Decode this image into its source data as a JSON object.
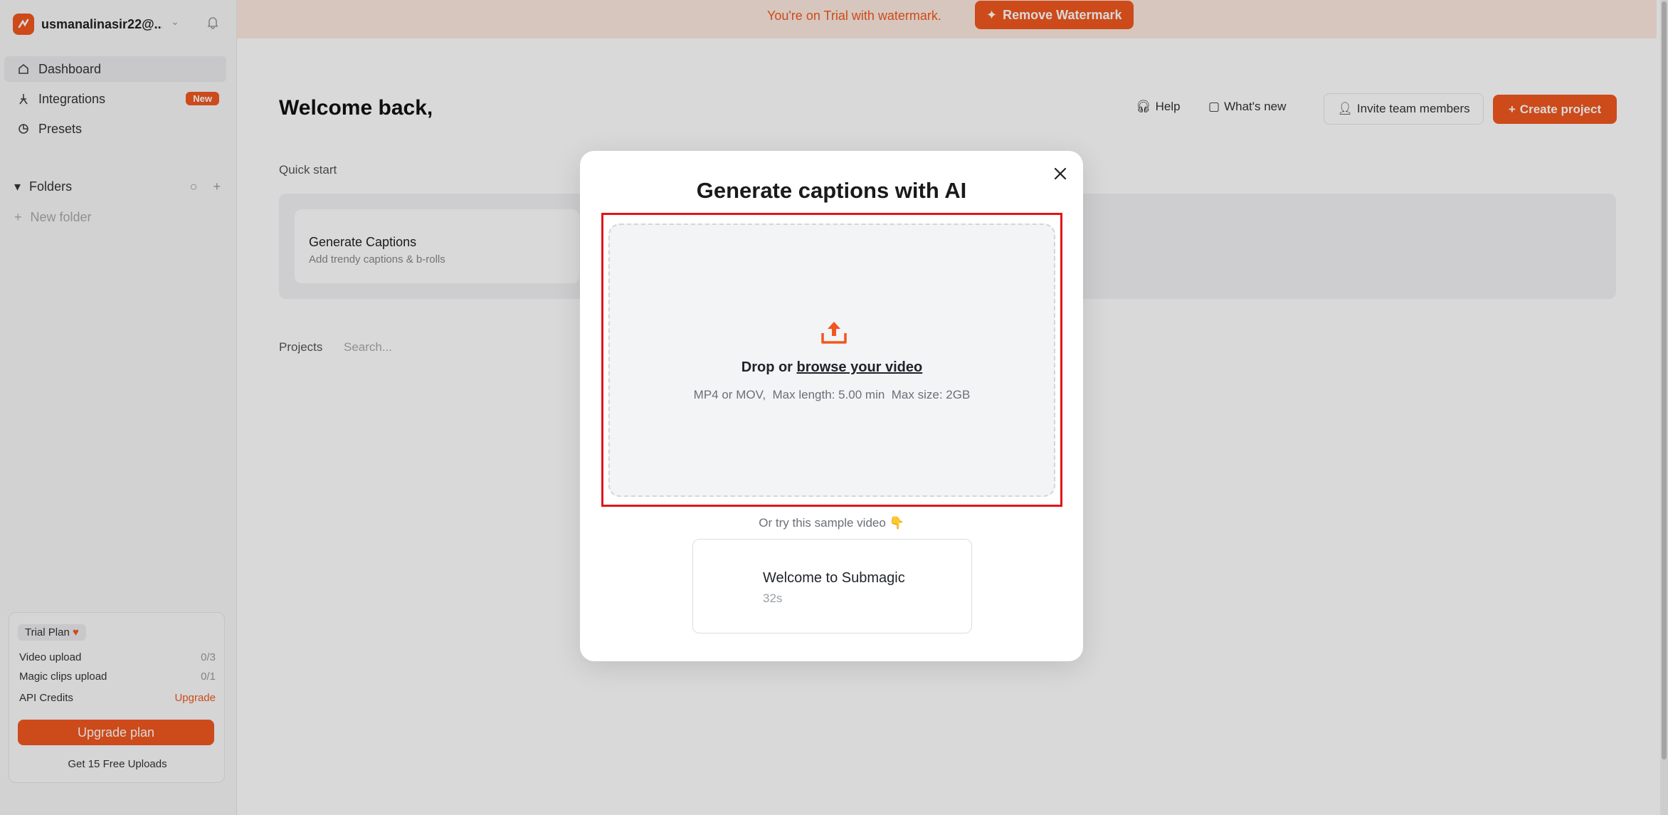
{
  "sidebar": {
    "account_name": "usmanalinasir22@...",
    "nav": [
      {
        "label": "Dashboard"
      },
      {
        "label": "Integrations",
        "badge": "New"
      },
      {
        "label": "Presets"
      }
    ],
    "folders_label": "Folders",
    "new_folder_label": "New folder",
    "plan": {
      "tag": "Trial Plan",
      "rows": [
        {
          "label": "Video upload",
          "value": "0/3"
        },
        {
          "label": "Magic clips upload",
          "value": "0/1"
        },
        {
          "label": "API Credits",
          "value": "Upgrade"
        }
      ],
      "upgrade_label": "Upgrade plan",
      "free_uploads": "Get 15 Free Uploads"
    }
  },
  "banner": {
    "text": "You're on Trial with watermark.",
    "button": "Remove Watermark"
  },
  "header": {
    "welcome": "Welcome back,",
    "help": "Help",
    "whats_new": "What's new",
    "invite": "Invite team members",
    "create": "Create project"
  },
  "main": {
    "quick_start": "Quick start",
    "quick_card": {
      "title": "Generate Captions",
      "subtitle": "Add trendy captions & b-rolls"
    },
    "projects_label": "Projects",
    "search_placeholder": "Search..."
  },
  "modal": {
    "title": "Generate captions with AI",
    "drop_prefix": "Drop or ",
    "browse_link": "browse your video",
    "hint": "MP4 or MOV,  Max length: 5.00 min  Max size: 2GB",
    "try_sample": "Or try this sample video 👇",
    "sample": {
      "title": "Welcome to Submagic",
      "duration": "32s"
    }
  },
  "colors": {
    "accent": "#f1571f",
    "highlight": "#e0161a"
  }
}
